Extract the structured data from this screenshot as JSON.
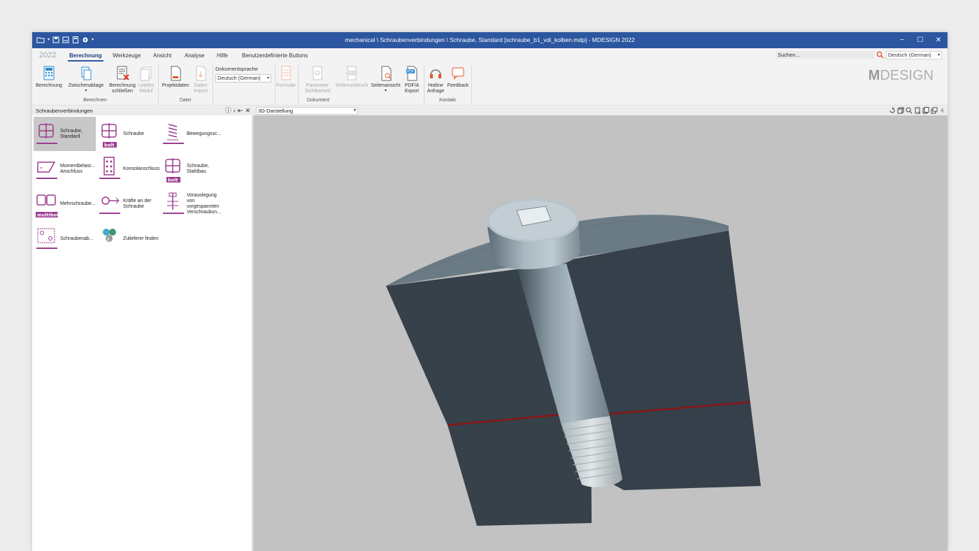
{
  "window": {
    "title": "mechanical \\ Schraubenverbindungen \\ Schraube, Standard [schraube_b1_vdi_kolben.mdp] - MDESIGN 2022",
    "controls": {
      "minimize": "−",
      "maximize": "☐",
      "close": "✕"
    }
  },
  "ribbon_tabs": {
    "year": "2022",
    "tabs": [
      "Berechnung",
      "Werkzeuge",
      "Ansicht",
      "Analyse",
      "Hilfe",
      "Benutzerdefinierte Buttons"
    ],
    "active": "Berechnung"
  },
  "search": {
    "placeholder": "Suchen..."
  },
  "language_top": {
    "value": "Deutsch (German)"
  },
  "ribbon": {
    "berechnung": "Berechnung",
    "zwischenablage": "Zwischenablage",
    "berechnung_schliessen_1": "Berechnung",
    "berechnung_schliessen_2": "schließen",
    "letztes_modul_1": "Letztes",
    "letztes_modul_2": "Modul",
    "group_berechnen": "Berechnen",
    "projektdaten": "Projektdaten",
    "daten_import_1": "Daten",
    "daten_import_2": "Import",
    "group_datei": "Datei",
    "dokumentsprache": "Dokumentsprache",
    "dokumentsprache_value": "Deutsch (German)",
    "formular": "Formular",
    "parameter_1": "Parameter",
    "parameter_2": "Sichtbarkeit",
    "seitenumbruch": "Seitenumbruch",
    "seitenansicht": "Seitenansicht",
    "pdfa_1": "PDF/A",
    "pdfa_2": "Export",
    "group_dokument": "Dokument",
    "hotline_1": "Hotline",
    "hotline_2": "Anfrage",
    "feedback": "Feedback",
    "group_kontakt": "Kontakt",
    "logo_m": "M",
    "logo_rest": "DESIGN"
  },
  "left_panel": {
    "title": "Schraubenverbindungen",
    "tiles": [
      {
        "line1": "Schraube,",
        "line2": "Standard",
        "line3": "",
        "line4": "",
        "badge": ""
      },
      {
        "line1": "Schraube",
        "line2": "",
        "line3": "",
        "line4": "",
        "badge": "bolt"
      },
      {
        "line1": "Bewegungssc...",
        "line2": "",
        "line3": "",
        "line4": "",
        "badge": ""
      },
      {
        "line1": "Momentbelast...",
        "line2": "Anschluss",
        "line3": "",
        "line4": "",
        "badge": ""
      },
      {
        "line1": "Konsolanschluss",
        "line2": "",
        "line3": "",
        "line4": "",
        "badge": ""
      },
      {
        "line1": "Schraube,",
        "line2": "Stahlbau",
        "line3": "",
        "line4": "",
        "badge": "bolt"
      },
      {
        "line1": "Mehrschraube...",
        "line2": "",
        "line3": "",
        "line4": "",
        "badge": "multibolt"
      },
      {
        "line1": "Kräfte an der",
        "line2": "Schraube",
        "line3": "",
        "line4": "",
        "badge": ""
      },
      {
        "line1": "Vorauslegung",
        "line2": "von",
        "line3": "vorgespannten",
        "line4": "Verschraubun...",
        "badge": ""
      },
      {
        "line1": "Schraubenab...",
        "line2": "",
        "line3": "",
        "line4": "",
        "badge": ""
      },
      {
        "line1": "Zulieferer finden",
        "line2": "",
        "line3": "",
        "line4": "",
        "badge": ""
      }
    ]
  },
  "viewport": {
    "mode": "3D-Darstellung"
  },
  "colors": {
    "titlebar": "#2c57a0",
    "accent_purple": "#9b3d8f",
    "viewport_bg": "#c2c2c2"
  }
}
